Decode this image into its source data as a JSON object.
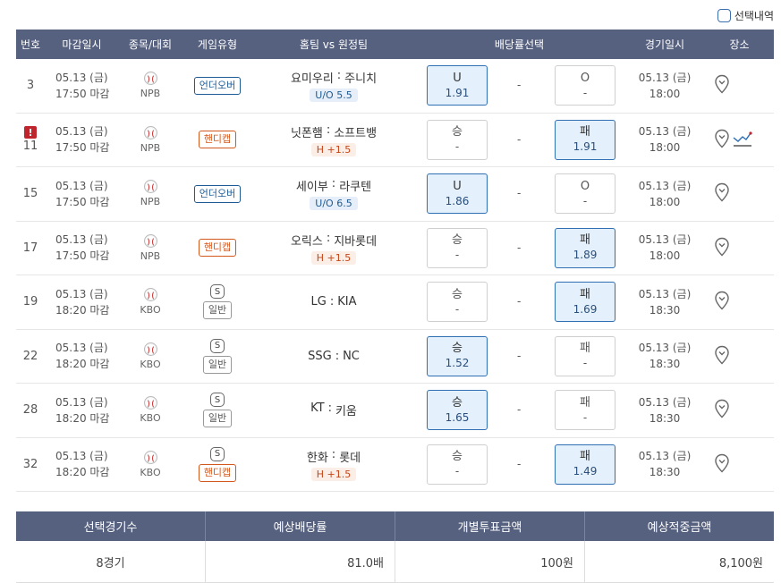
{
  "top": {
    "selection_label": "선택내역"
  },
  "header": {
    "no": "번호",
    "deadline": "마감일시",
    "event": "종목/대회",
    "game_type": "게임유형",
    "teams": "홈팀 vs 원정팀",
    "odds": "배당률선택",
    "game_datetime": "경기일시",
    "place": "장소"
  },
  "rows": [
    {
      "no": "3",
      "warn": false,
      "dl_date": "05.13 (금)",
      "dl_time": "17:50 마감",
      "league": "NPB",
      "s_badge": "",
      "type_label": "언더오버",
      "type_kind": "uo",
      "home": "요미우리",
      "sep": ":",
      "away": "주니치",
      "handi": "U/O 5.5",
      "handi_kind": "uo",
      "left_label": "U",
      "left_val": "1.91",
      "left_sel": true,
      "mid": "-",
      "right_label": "O",
      "right_val": "-",
      "right_sel": false,
      "g_date": "05.13 (금)",
      "g_time": "18:00"
    },
    {
      "no": "11",
      "warn": true,
      "warn_glyph": "!",
      "dl_date": "05.13 (금)",
      "dl_time": "17:50 마감",
      "league": "NPB",
      "s_badge": "",
      "type_label": "핸디캡",
      "type_kind": "hc",
      "home": "닛폰햄",
      "sep": ":",
      "away": "소프트뱅",
      "handi": "H +1.5",
      "handi_kind": "hc",
      "left_label": "승",
      "left_val": "-",
      "left_sel": false,
      "mid": "-",
      "right_label": "패",
      "right_val": "1.91",
      "right_sel": true,
      "g_date": "05.13 (금)",
      "g_time": "18:00",
      "chart_icon": true
    },
    {
      "no": "15",
      "warn": false,
      "dl_date": "05.13 (금)",
      "dl_time": "17:50 마감",
      "league": "NPB",
      "s_badge": "",
      "type_label": "언더오버",
      "type_kind": "uo",
      "home": "세이부",
      "sep": ":",
      "away": "라쿠텐",
      "handi": "U/O 6.5",
      "handi_kind": "uo",
      "left_label": "U",
      "left_val": "1.86",
      "left_sel": true,
      "mid": "-",
      "right_label": "O",
      "right_val": "-",
      "right_sel": false,
      "g_date": "05.13 (금)",
      "g_time": "18:00"
    },
    {
      "no": "17",
      "warn": false,
      "dl_date": "05.13 (금)",
      "dl_time": "17:50 마감",
      "league": "NPB",
      "s_badge": "",
      "type_label": "핸디캡",
      "type_kind": "hc",
      "home": "오릭스",
      "sep": ":",
      "away": "지바롯데",
      "handi": "H +1.5",
      "handi_kind": "hc",
      "left_label": "승",
      "left_val": "-",
      "left_sel": false,
      "mid": "-",
      "right_label": "패",
      "right_val": "1.89",
      "right_sel": true,
      "g_date": "05.13 (금)",
      "g_time": "18:00"
    },
    {
      "no": "19",
      "warn": false,
      "dl_date": "05.13 (금)",
      "dl_time": "18:20 마감",
      "league": "KBO",
      "s_badge": "S",
      "type_label": "일반",
      "type_kind": "gen",
      "home": "LG",
      "sep": ":",
      "away": "KIA",
      "handi": "",
      "handi_kind": "",
      "left_label": "승",
      "left_val": "-",
      "left_sel": false,
      "mid": "-",
      "right_label": "패",
      "right_val": "1.69",
      "right_sel": true,
      "g_date": "05.13 (금)",
      "g_time": "18:30"
    },
    {
      "no": "22",
      "warn": false,
      "dl_date": "05.13 (금)",
      "dl_time": "18:20 마감",
      "league": "KBO",
      "s_badge": "S",
      "type_label": "일반",
      "type_kind": "gen",
      "home": "SSG",
      "sep": ":",
      "away": "NC",
      "handi": "",
      "handi_kind": "",
      "left_label": "승",
      "left_val": "1.52",
      "left_sel": true,
      "mid": "-",
      "right_label": "패",
      "right_val": "-",
      "right_sel": false,
      "g_date": "05.13 (금)",
      "g_time": "18:30"
    },
    {
      "no": "28",
      "warn": false,
      "dl_date": "05.13 (금)",
      "dl_time": "18:20 마감",
      "league": "KBO",
      "s_badge": "S",
      "type_label": "일반",
      "type_kind": "gen",
      "home": "KT",
      "sep": ":",
      "away": "키움",
      "handi": "",
      "handi_kind": "",
      "left_label": "승",
      "left_val": "1.65",
      "left_sel": true,
      "mid": "-",
      "right_label": "패",
      "right_val": "-",
      "right_sel": false,
      "g_date": "05.13 (금)",
      "g_time": "18:30"
    },
    {
      "no": "32",
      "warn": false,
      "dl_date": "05.13 (금)",
      "dl_time": "18:20 마감",
      "league": "KBO",
      "s_badge": "S",
      "type_label": "핸디캡",
      "type_kind": "hc",
      "home": "한화",
      "sep": ":",
      "away": "롯데",
      "handi": "H +1.5",
      "handi_kind": "hc",
      "left_label": "승",
      "left_val": "-",
      "left_sel": false,
      "mid": "-",
      "right_label": "패",
      "right_val": "1.49",
      "right_sel": true,
      "g_date": "05.13 (금)",
      "g_time": "18:30"
    }
  ],
  "summary": {
    "headers": [
      "선택경기수",
      "예상배당률",
      "개별투표금액",
      "예상적중금액"
    ],
    "values": [
      "8경기",
      "81.0배",
      "100원",
      "8,100원"
    ]
  },
  "colors": {
    "header_bg": "#56607f",
    "selected_bg": "#e4f0fb",
    "selected_border": "#2f6fb2",
    "uo": "#1e5b94",
    "handicap": "#d2581d",
    "warn": "#c0252d"
  }
}
